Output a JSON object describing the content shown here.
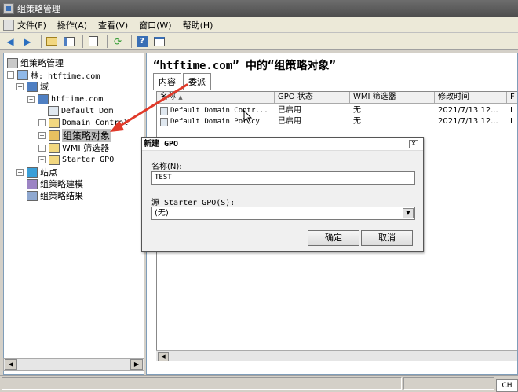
{
  "window": {
    "title": "组策略管理"
  },
  "menu": {
    "items": [
      "文件(F)",
      "操作(A)",
      "查看(V)",
      "窗口(W)",
      "帮助(H)"
    ]
  },
  "toolbar": {
    "icons": [
      "back-icon",
      "forward-icon",
      "up-folder-icon",
      "show-hide-tree-icon",
      "properties-icon",
      "refresh-icon",
      "help-icon",
      "console-icon"
    ],
    "help_glyph": "?"
  },
  "tree": {
    "root": "组策略管理",
    "forest": "林: htftime.com",
    "domains": "域",
    "domain": "htftime.com",
    "default_domain_policy": "Default Dom",
    "domain_controllers": "Domain Control",
    "gpo_container": "组策略对象",
    "wmi_filters": "WMI 筛选器",
    "starter_gpo": "Starter GPO",
    "sites": "站点",
    "modeling": "组策略建模",
    "results": "组策略结果"
  },
  "content": {
    "title": "“htftime.com” 中的“组策略对象”",
    "tabs": [
      "内容",
      "委派"
    ],
    "columns": [
      "名称",
      "GPO 状态",
      "WMI 筛选器",
      "修改时间",
      "F"
    ],
    "rows": [
      {
        "name": "Default Domain Contr...",
        "status": "已启用",
        "wmi": "无",
        "modified": "2021/7/13 12...",
        "extra": "I"
      },
      {
        "name": "Default Domain Policy",
        "status": "已启用",
        "wmi": "无",
        "modified": "2021/7/13 12...",
        "extra": "I"
      }
    ]
  },
  "dialog": {
    "title": "新建 GPO",
    "name_label": "名称(N):",
    "name_value": "TEST",
    "source_label": "源 Starter GPO(S):",
    "source_value": "(无)",
    "ok": "确定",
    "cancel": "取消",
    "close_glyph": "x"
  },
  "statusbar": {
    "lang": "CH"
  },
  "colors": {
    "titlebar": "#5a5a5a",
    "annotation_arrow": "#e03a2a"
  }
}
